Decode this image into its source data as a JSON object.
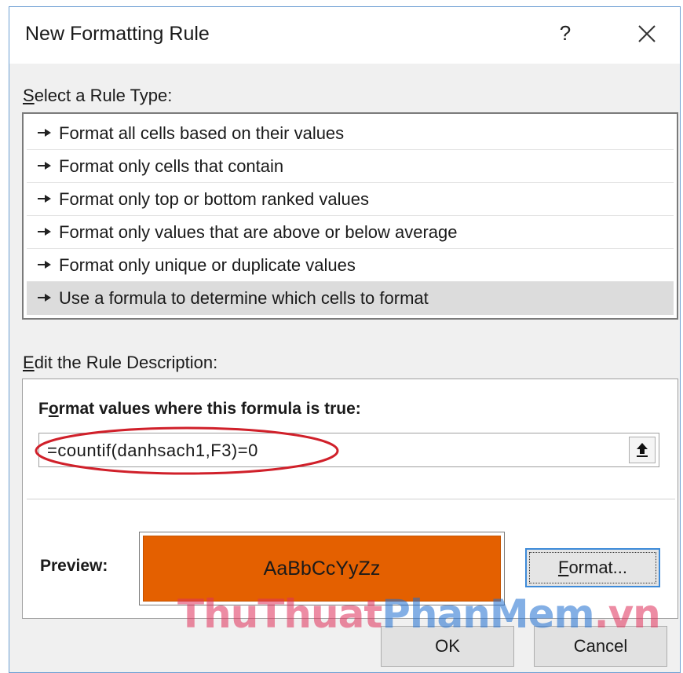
{
  "dialog": {
    "title": "New Formatting Rule",
    "help_label": "?",
    "close_icon": "close-icon"
  },
  "rule_type": {
    "label_first": "S",
    "label_rest": "elect a Rule Type:",
    "items": [
      {
        "label": "Format all cells based on their values"
      },
      {
        "label": "Format only cells that contain"
      },
      {
        "label": "Format only top or bottom ranked values"
      },
      {
        "label": "Format only values that are above or below average"
      },
      {
        "label": "Format only unique or duplicate values"
      },
      {
        "label": "Use a formula to determine which cells to format",
        "selected": true
      }
    ],
    "item_icon": "arrow-right-icon"
  },
  "description": {
    "label_first": "E",
    "label_rest": "dit the Rule Description:",
    "formula_label_pre": "F",
    "formula_label_u": "o",
    "formula_label_post": "rmat values where this formula is true:",
    "formula_value": "=countif(danhsach1,F3)=0",
    "collapse_icon": "collapse-dialog-icon",
    "annotation_color": "#d0202a"
  },
  "preview": {
    "label": "Preview:",
    "sample_text": "AaBbCcYyZz",
    "fill_color": "#e46000",
    "format_button_first": "F",
    "format_button_rest": "ormat..."
  },
  "buttons": {
    "ok": "OK",
    "cancel": "Cancel"
  },
  "watermark": {
    "part1": "ThuThuat",
    "part2": "PhanMem",
    "part3": ".vn"
  }
}
